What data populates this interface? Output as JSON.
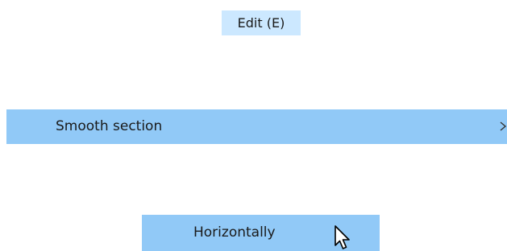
{
  "menu": {
    "title": "Edit (E)"
  },
  "submenu": {
    "label": "Smooth section",
    "arrow_icon": "chevron-right-icon"
  },
  "option": {
    "label": "Horizontally"
  },
  "cursor": {
    "icon": "mouse-pointer-icon"
  },
  "colors": {
    "title_highlight": "#cce8ff",
    "item_highlight": "#91c9f7"
  }
}
